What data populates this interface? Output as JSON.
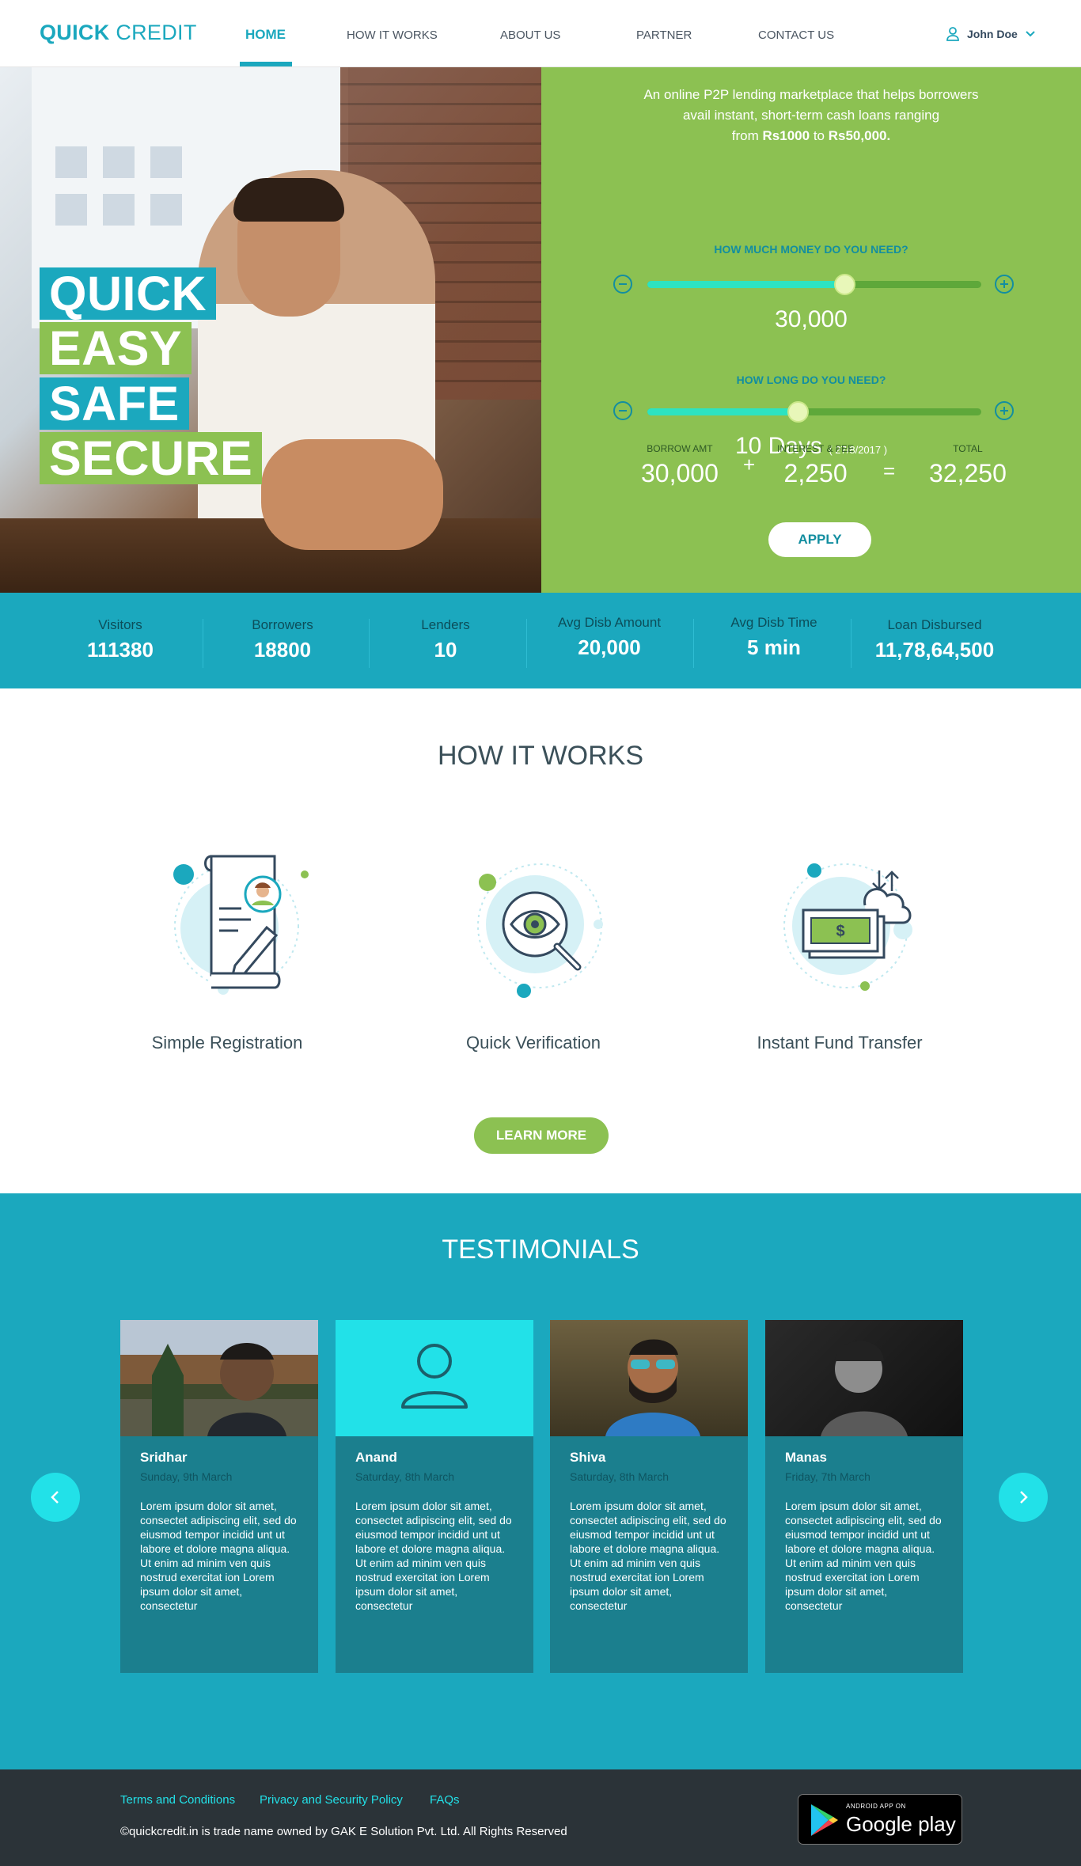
{
  "nav": {
    "logo_bold": "QUICK",
    "logo_regular": "CREDIT",
    "links": [
      "HOME",
      "HOW IT WORKS",
      "ABOUT US",
      "PARTNER",
      "CONTACT US"
    ],
    "user_name": "John Doe"
  },
  "hero": {
    "tags": [
      "QUICK",
      "EASY",
      "SAFE",
      "SECURE"
    ]
  },
  "calculator": {
    "intro_line1": "An online P2P lending marketplace that helps borrowers",
    "intro_line2": "avail instant, short-term cash loans ranging",
    "intro_from": "from",
    "intro_min": "Rs1000",
    "intro_to": "to",
    "intro_max": "Rs50,000.",
    "amount_question": "HOW MUCH MONEY DO YOU NEED?",
    "amount_value": "30,000",
    "amount_slider_fraction": 0.59,
    "duration_question": "HOW LONG DO YOU NEED?",
    "duration_value": "10 Days",
    "duration_date": "( 27/8/2017 )",
    "duration_slider_fraction": 0.45,
    "borrow_label": "BORROW AMT",
    "borrow_value": "30,000",
    "interest_label": "INTEREST & FEE",
    "interest_value": "2,250",
    "total_label": "TOTAL",
    "total_value": "32,250",
    "plus": "+",
    "equals": "=",
    "apply_label": "APPLY"
  },
  "stats": [
    {
      "label": "Visitors",
      "value": "111380"
    },
    {
      "label": "Borrowers",
      "value": "18800"
    },
    {
      "label": "Lenders",
      "value": "10"
    },
    {
      "label": "Avg Disb Amount",
      "value": "20,000"
    },
    {
      "label": "Avg Disb Time",
      "value": "5 min"
    },
    {
      "label": "Loan Disbursed",
      "value": "11,78,64,500"
    }
  ],
  "how_it_works": {
    "title": "HOW IT WORKS",
    "steps": [
      "Simple Registration",
      "Quick Verification",
      "Instant Fund Transfer"
    ],
    "learn_more": "LEARN MORE"
  },
  "testimonials": {
    "title": "TESTIMONIALS",
    "cards": [
      {
        "name": "Sridhar",
        "date": "Sunday, 9th March",
        "text": "Lorem ipsum dolor sit amet, consectet adipiscing elit, sed do eiusmod tempor incidid unt ut labore et dolore magna aliqua. Ut enim ad minim ven quis nostrud exercitat ion Lorem ipsum dolor sit amet, consectetur"
      },
      {
        "name": "Anand",
        "date": "Saturday, 8th March",
        "text": "Lorem ipsum dolor sit amet, consectet adipiscing elit, sed do eiusmod tempor incidid unt ut labore et dolore magna aliqua. Ut enim ad minim ven quis nostrud exercitat ion Lorem ipsum dolor sit amet, consectetur"
      },
      {
        "name": "Shiva",
        "date": "Saturday, 8th March",
        "text": "Lorem ipsum dolor sit amet, consectet adipiscing elit, sed do eiusmod tempor incidid unt ut labore et dolore magna aliqua. Ut enim ad minim ven quis nostrud exercitat ion Lorem ipsum dolor sit amet, consectetur"
      },
      {
        "name": "Manas",
        "date": "Friday, 7th March",
        "text": "Lorem ipsum dolor sit amet, consectet adipiscing elit, sed do eiusmod tempor incidid unt ut labore et dolore magna aliqua. Ut enim ad minim ven quis nostrud exercitat ion Lorem ipsum dolor sit amet, consectetur"
      }
    ]
  },
  "footer": {
    "links": [
      "Terms and Conditions",
      "Privacy and Security Policy",
      "FAQs"
    ],
    "copyright": "©quickcredit.in is trade name owned by GAK E Solution Pvt. Ltd. All Rights Reserved",
    "store_small": "ANDROID APP ON",
    "store_big": "Google play"
  },
  "colors": {
    "teal": "#1ba8be",
    "green": "#8cc152",
    "dark": "#2b3338",
    "cyan_accent": "#22e1e8"
  },
  "icons": [
    "user-icon",
    "chevron-down-icon",
    "minus-icon",
    "plus-icon",
    "registration-icon",
    "verification-eye-icon",
    "fund-transfer-icon",
    "avatar-icon",
    "chevron-left-icon",
    "chevron-right-icon",
    "google-play-icon"
  ]
}
